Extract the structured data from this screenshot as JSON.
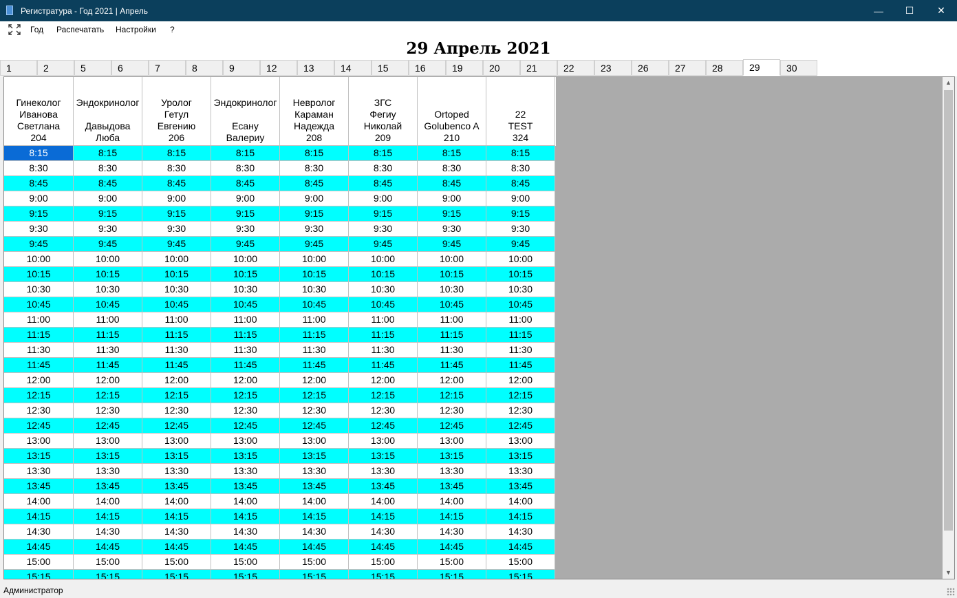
{
  "window": {
    "title": "Регистратура - Год 2021 | Апрель"
  },
  "menu": {
    "items": [
      "Год",
      "Распечатать",
      "Настройки",
      "?"
    ]
  },
  "heading": "29 Апрель 2021",
  "tabs": [
    "1",
    "2",
    "5",
    "6",
    "7",
    "8",
    "9",
    "12",
    "13",
    "14",
    "15",
    "16",
    "19",
    "20",
    "21",
    "22",
    "23",
    "26",
    "27",
    "28",
    "29",
    "30"
  ],
  "active_tab": "29",
  "columns": [
    [
      "Гинеколог",
      "Иванова",
      "Светлана",
      "204"
    ],
    [
      "Эндокринолог",
      "",
      "Давыдова",
      "Люба"
    ],
    [
      "Уролог",
      "Гетул",
      "Евгению",
      "206"
    ],
    [
      "Эндокринолог",
      "",
      "Есану",
      "Валериу"
    ],
    [
      "Невролог",
      "Караман",
      "Надежда",
      "208"
    ],
    [
      "ЗГС",
      "Фегиу",
      "Николай",
      "209"
    ],
    [
      "Ortoped",
      "Golubenco A",
      "210"
    ],
    [
      "22",
      "TEST",
      "324"
    ]
  ],
  "times": [
    "8:15",
    "8:30",
    "8:45",
    "9:00",
    "9:15",
    "9:30",
    "9:45",
    "10:00",
    "10:15",
    "10:30",
    "10:45",
    "11:00",
    "11:15",
    "11:30",
    "11:45",
    "12:00",
    "12:15",
    "12:30",
    "12:45",
    "13:00",
    "13:15",
    "13:30",
    "13:45",
    "14:00",
    "14:15",
    "14:30",
    "14:45",
    "15:00",
    "15:15"
  ],
  "colors": {
    "cyan_row": "#00ffff",
    "white_row": "#ffffff",
    "selected": "#0a6bd6",
    "titlebar": "#0b3f5c",
    "empty_area": "#ababab"
  },
  "status": "Администратор"
}
